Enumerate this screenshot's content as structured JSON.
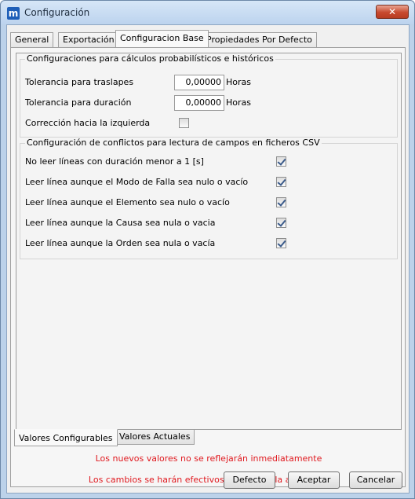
{
  "window": {
    "title": "Configuración",
    "app_icon_glyph": "m",
    "close_glyph": "✕"
  },
  "tabs": [
    "General",
    "Exportación",
    "Configuracion Base",
    "Propiedades Por Defecto"
  ],
  "active_tab": "Configuracion Base",
  "group_prob": {
    "legend": "Configuraciones para cálculos probabilísticos e históricos",
    "tolerancia_traslapes": {
      "label": "Tolerancia para traslapes",
      "value": "0,00000",
      "unit": "Horas"
    },
    "tolerancia_duracion": {
      "label": "Tolerancia para duración",
      "value": "0,00000",
      "unit": "Horas"
    },
    "correccion": {
      "label": "Corrección hacia la izquierda",
      "checked": false
    }
  },
  "group_csv": {
    "legend": "Configuración de conflictos para lectura de campos en ficheros CSV",
    "items": [
      {
        "label": "No leer líneas con duración menor a 1 [s]",
        "checked": true
      },
      {
        "label": "Leer línea aunque el Modo de Falla sea nulo o vacío",
        "checked": true
      },
      {
        "label": "Leer línea aunque el Elemento sea nulo o vacío",
        "checked": true
      },
      {
        "label": "Leer línea aunque la Causa sea nula o vacia",
        "checked": true
      },
      {
        "label": "Leer línea aunque la Orden sea nula o vacía",
        "checked": true
      }
    ]
  },
  "bottom_tabs": [
    "Valores Configurables",
    "Valores Actuales"
  ],
  "notes": [
    "Los nuevos valores no se reflejarán inmediatamente",
    "Los cambios se harán efectivos al reiniciar la aplicación"
  ],
  "buttons": {
    "defecto": "Defecto",
    "aceptar": "Aceptar",
    "cancelar": "Cancelar"
  },
  "colors": {
    "note": "#e0191f",
    "title_bar": "#bcd3ee",
    "close_button": "#c7492e"
  }
}
